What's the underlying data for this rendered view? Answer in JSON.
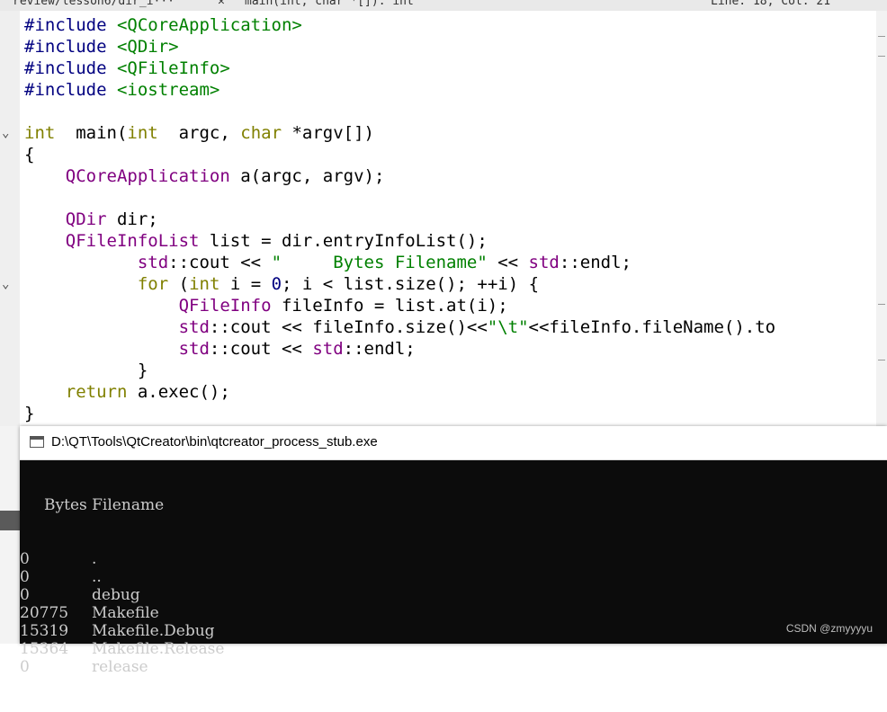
{
  "toolbar": {
    "file_tab": "review/lesson6/dir_i···",
    "symbol": "main(int, char *[]): int",
    "position": "Line: 18, Col: 21"
  },
  "code_lines": [
    [
      [
        "pp",
        "#include "
      ],
      [
        "inc",
        "<QCoreApplication>"
      ]
    ],
    [
      [
        "pp",
        "#include "
      ],
      [
        "inc",
        "<QDir>"
      ]
    ],
    [
      [
        "pp",
        "#include "
      ],
      [
        "inc",
        "<QFileInfo>"
      ]
    ],
    [
      [
        "pp",
        "#include "
      ],
      [
        "inc",
        "<iostream>"
      ]
    ],
    [],
    [
      [
        "kw",
        "int"
      ],
      [
        "",
        "  main("
      ],
      [
        "kw",
        "int"
      ],
      [
        "",
        "  argc, "
      ],
      [
        "kw",
        "char"
      ],
      [
        "",
        " *argv[])"
      ]
    ],
    [
      [
        "",
        "{"
      ]
    ],
    [
      [
        "",
        "    "
      ],
      [
        "ty",
        "QCoreApplication"
      ],
      [
        "",
        " a(argc, argv);"
      ]
    ],
    [],
    [
      [
        "",
        "    "
      ],
      [
        "ty",
        "QDir"
      ],
      [
        "",
        " dir;"
      ]
    ],
    [
      [
        "",
        "    "
      ],
      [
        "ty",
        "QFileInfoList"
      ],
      [
        "",
        " list = dir.entryInfoList();"
      ]
    ],
    [
      [
        "",
        "           "
      ],
      [
        "ty",
        "std"
      ],
      [
        "",
        "::cout << "
      ],
      [
        "st",
        "\"     Bytes Filename\""
      ],
      [
        "",
        " << "
      ],
      [
        "ty",
        "std"
      ],
      [
        "",
        "::endl;"
      ]
    ],
    [
      [
        "",
        "           "
      ],
      [
        "kw",
        "for"
      ],
      [
        "",
        " ("
      ],
      [
        "kw",
        "int"
      ],
      [
        "",
        " i = "
      ],
      [
        "num",
        "0"
      ],
      [
        "",
        "; i < list.size(); ++i) {"
      ]
    ],
    [
      [
        "",
        "               "
      ],
      [
        "ty",
        "QFileInfo"
      ],
      [
        "",
        " fileInfo = list.at(i);"
      ]
    ],
    [
      [
        "",
        "               "
      ],
      [
        "ty",
        "std"
      ],
      [
        "",
        "::cout << fileInfo.size()<<"
      ],
      [
        "st",
        "\"\\t\""
      ],
      [
        "",
        "<<fileInfo.fileName().to"
      ]
    ],
    [
      [
        "",
        "               "
      ],
      [
        "ty",
        "std"
      ],
      [
        "",
        "::cout << "
      ],
      [
        "ty",
        "std"
      ],
      [
        "",
        "::endl;"
      ]
    ],
    [
      [
        "",
        "           }"
      ]
    ],
    [
      [
        "",
        "    "
      ],
      [
        "kw",
        "return"
      ],
      [
        "",
        " a.exec();"
      ]
    ],
    [
      [
        "",
        "}"
      ]
    ]
  ],
  "console": {
    "title": "D:\\QT\\Tools\\QtCreator\\bin\\qtcreator_process_stub.exe",
    "header": "     Bytes Filename",
    "rows": [
      {
        "size": "0",
        "name": ".",
        "color": "#cccccc"
      },
      {
        "size": "0",
        "name": "..",
        "color": "#cccccc"
      },
      {
        "size": "0",
        "name": "debug",
        "color": "#cccccc"
      },
      {
        "size": "20775",
        "name": "Makefile",
        "color": "#cccccc"
      },
      {
        "size": "15319",
        "name": "Makefile.Debug",
        "color": "#cccccc"
      },
      {
        "size": "15364",
        "name": "Makefile.Release",
        "color": "#cccccc"
      },
      {
        "size": "0",
        "name": "release",
        "color": "#cccccc"
      }
    ],
    "watermark": "CSDN @zmyyyyu"
  }
}
